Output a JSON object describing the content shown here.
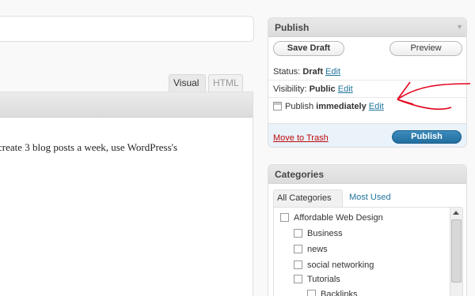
{
  "editor": {
    "tabs": {
      "visual": "Visual",
      "html": "HTML"
    },
    "content": "create 3 blog posts a week, use WordPress's"
  },
  "publish": {
    "title": "Publish",
    "save_draft": "Save Draft",
    "preview": "Preview",
    "status_label": "Status:",
    "status_value": "Draft",
    "visibility_label": "Visibility:",
    "visibility_value": "Public",
    "schedule_label": "Publish",
    "schedule_value": "immediately",
    "edit_label": "Edit",
    "move_to_trash": "Move to Trash",
    "publish_button": "Publish"
  },
  "categories": {
    "title": "Categories",
    "tab_all": "All Categories",
    "tab_used": "Most Used",
    "items": [
      {
        "label": "Affordable Web Design",
        "level": 0
      },
      {
        "label": "Business",
        "level": 1
      },
      {
        "label": "news",
        "level": 1
      },
      {
        "label": "social networking",
        "level": 1
      },
      {
        "label": "Tutorials",
        "level": 1
      },
      {
        "label": "Backlinks",
        "level": 2
      }
    ]
  },
  "colors": {
    "link": "#21759b",
    "trash": "#bc0b0b",
    "publish_button": "#216e9e",
    "annotation": "#e3001b"
  },
  "icons": [
    "collapse-arrow-icon",
    "calendar-icon",
    "scroll-up-icon"
  ]
}
